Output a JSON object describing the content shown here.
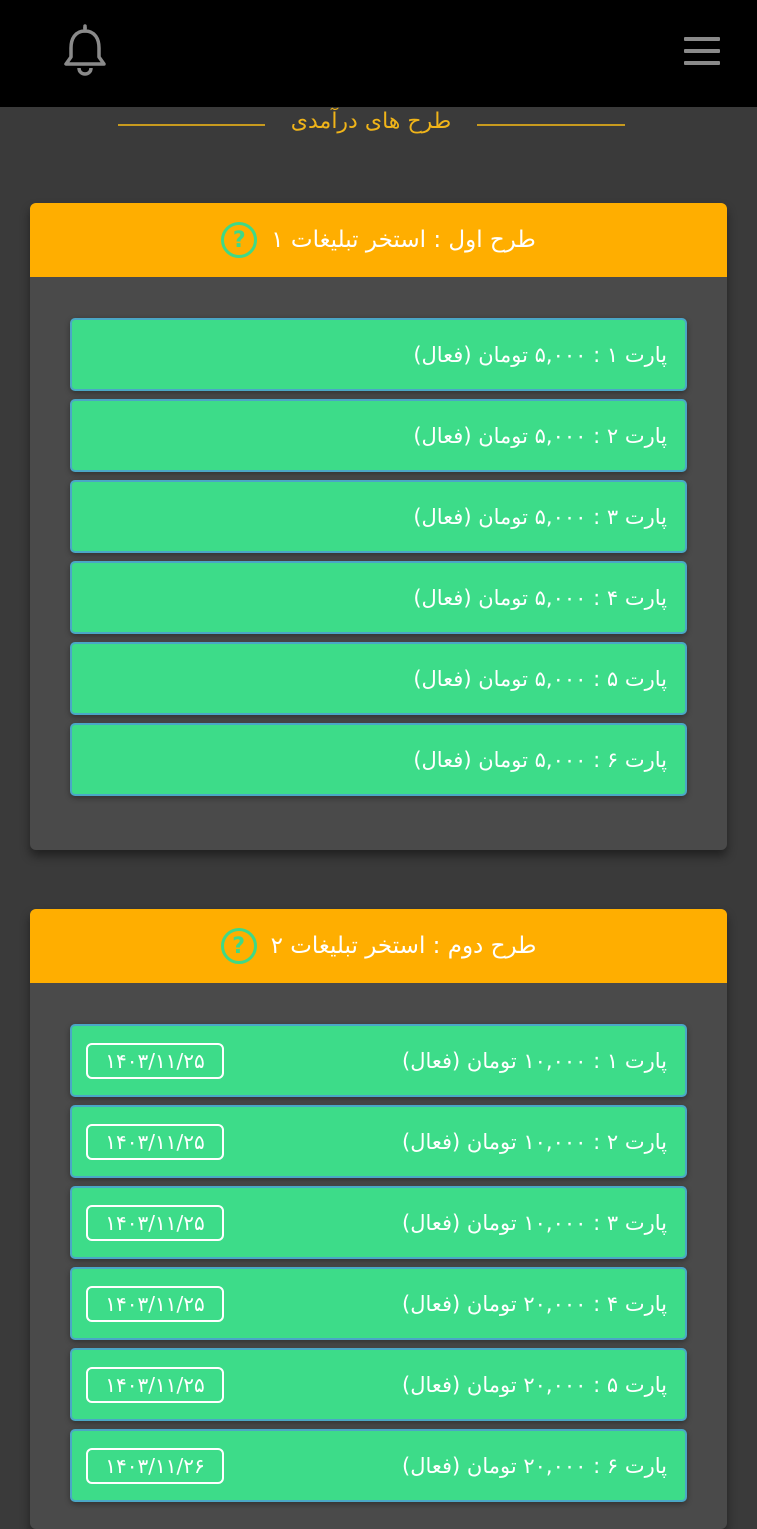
{
  "header": {
    "bell_icon": "bell-icon",
    "menu_icon": "hamburger-menu-icon"
  },
  "section": {
    "title": "طرح های درآمدی"
  },
  "colors": {
    "topbar": "#000000",
    "background": "#3a3a3a",
    "card": "#4a4a4a",
    "header_accent": "#ffae00",
    "row_green": "#3ddc89",
    "title_gold": "#f0b419"
  },
  "plans": [
    {
      "title": "طرح اول : استخر تبلیغات ۱",
      "help_icon": "question-mark-icon",
      "parts": [
        {
          "label": "پارت ۱ : ۵,۰۰۰ تومان (فعال)"
        },
        {
          "label": "پارت ۲ : ۵,۰۰۰ تومان (فعال)"
        },
        {
          "label": "پارت ۳ : ۵,۰۰۰ تومان (فعال)"
        },
        {
          "label": "پارت ۴ : ۵,۰۰۰ تومان (فعال)"
        },
        {
          "label": "پارت ۵ : ۵,۰۰۰ تومان (فعال)"
        },
        {
          "label": "پارت ۶ : ۵,۰۰۰ تومان (فعال)"
        }
      ]
    },
    {
      "title": "طرح دوم : استخر تبلیغات ۲",
      "help_icon": "question-mark-icon",
      "parts": [
        {
          "label": "پارت ۱ : ۱۰,۰۰۰ تومان (فعال)",
          "date": "۱۴۰۳/۱۱/۲۵"
        },
        {
          "label": "پارت ۲ : ۱۰,۰۰۰ تومان (فعال)",
          "date": "۱۴۰۳/۱۱/۲۵"
        },
        {
          "label": "پارت ۳ : ۱۰,۰۰۰ تومان (فعال)",
          "date": "۱۴۰۳/۱۱/۲۵"
        },
        {
          "label": "پارت ۴ : ۲۰,۰۰۰ تومان (فعال)",
          "date": "۱۴۰۳/۱۱/۲۵"
        },
        {
          "label": "پارت ۵ : ۲۰,۰۰۰ تومان (فعال)",
          "date": "۱۴۰۳/۱۱/۲۵"
        },
        {
          "label": "پارت ۶ : ۲۰,۰۰۰ تومان (فعال)",
          "date": "۱۴۰۳/۱۱/۲۶"
        }
      ]
    }
  ]
}
